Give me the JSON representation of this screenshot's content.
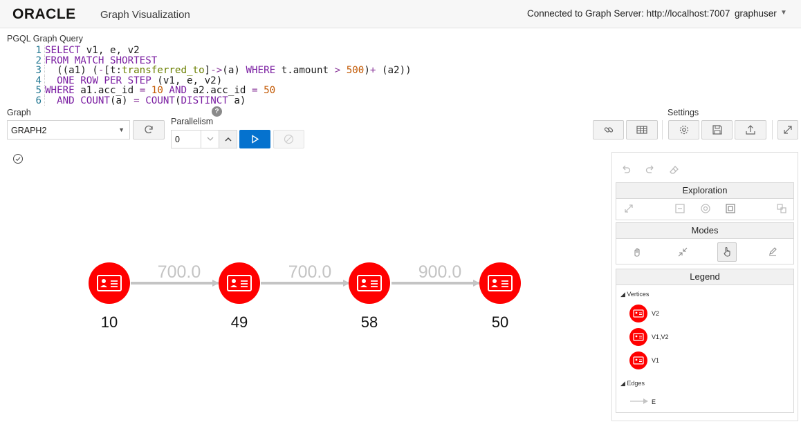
{
  "header": {
    "logo": "ORACLE",
    "app_title": "Graph Visualization",
    "connection": "Connected to Graph Server: http://localhost:7007",
    "user": "graphuser"
  },
  "query": {
    "label": "PGQL Graph Query",
    "lines": [
      {
        "n": "1"
      },
      {
        "n": "2"
      },
      {
        "n": "3"
      },
      {
        "n": "4"
      },
      {
        "n": "5"
      },
      {
        "n": "6"
      }
    ]
  },
  "controls": {
    "graph_label": "Graph",
    "graph_value": "GRAPH2",
    "parallelism_label": "Parallelism",
    "parallelism_value": "0",
    "settings_label": "Settings",
    "help": "?"
  },
  "graph": {
    "vertices": [
      {
        "label": "10"
      },
      {
        "label": "49"
      },
      {
        "label": "58"
      },
      {
        "label": "50"
      }
    ],
    "edges": [
      {
        "label": "700.0"
      },
      {
        "label": "700.0"
      },
      {
        "label": "900.0"
      }
    ],
    "colors": {
      "vertex": "#ff0000",
      "edge": "#c4c4c4"
    }
  },
  "panel": {
    "exploration": "Exploration",
    "modes": "Modes",
    "legend": "Legend",
    "legend_vertices_title": "Vertices",
    "legend_vertices": [
      "V2",
      "V1,V2",
      "V1"
    ],
    "legend_edges_title": "Edges",
    "legend_edges": [
      "E"
    ]
  }
}
